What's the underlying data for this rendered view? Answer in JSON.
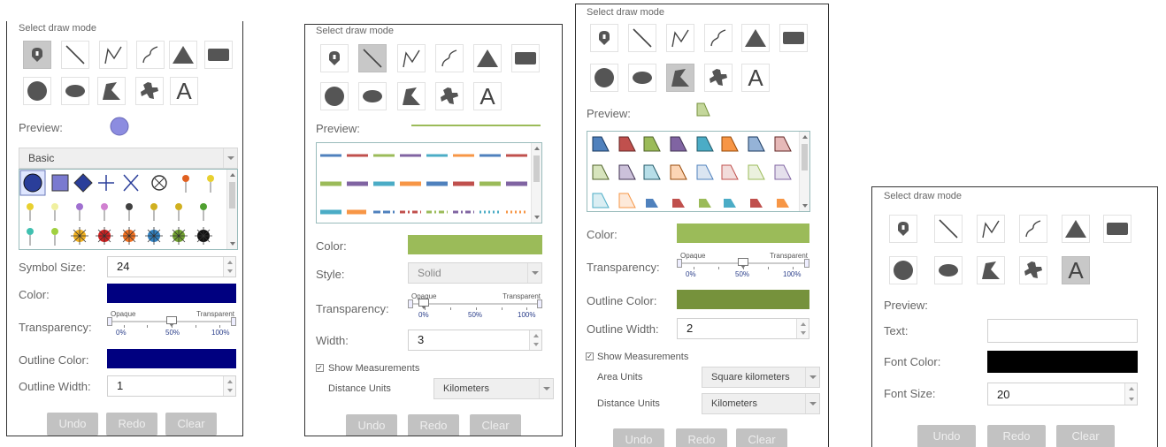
{
  "common": {
    "select_draw_mode": "Select draw mode",
    "preview": "Preview:",
    "text_glyph": "A",
    "undo": "Undo",
    "redo": "Redo",
    "clear": "Clear",
    "color": "Color:",
    "transparency": "Transparency:",
    "opaque": "Opaque",
    "transparent": "Transparent",
    "pct0": "0%",
    "pct50": "50%",
    "pct100": "100%",
    "outline_color": "Outline Color:",
    "outline_width": "Outline Width:",
    "show_measurements": "Show Measurements",
    "distance_units": "Distance Units",
    "area_units": "Area Units"
  },
  "panel1": {
    "mode": "point",
    "symbol_category": "Basic",
    "symbol_size_label": "Symbol Size:",
    "symbol_size": "24",
    "color": "#000080",
    "transparency": 0.5,
    "outline_color": "#000080",
    "outline_width": "1"
  },
  "panel2": {
    "mode": "line",
    "color": "#9bbb59",
    "style_label": "Style:",
    "style": "Solid",
    "transparency": 0.0,
    "width_label": "Width:",
    "width": "3",
    "show_measurements": true,
    "distance_units": "Kilometers"
  },
  "panel3": {
    "mode": "polygon",
    "color": "#9bbb59",
    "transparency": 0.5,
    "outline_color": "#76923c",
    "outline_width": "2",
    "show_measurements": true,
    "area_units": "Square kilometers",
    "distance_units": "Kilometers"
  },
  "panel4": {
    "mode": "text",
    "text_label": "Text:",
    "text_value": "",
    "font_color_label": "Font Color:",
    "font_color": "#000000",
    "font_size_label": "Font Size:",
    "font_size": "20"
  }
}
